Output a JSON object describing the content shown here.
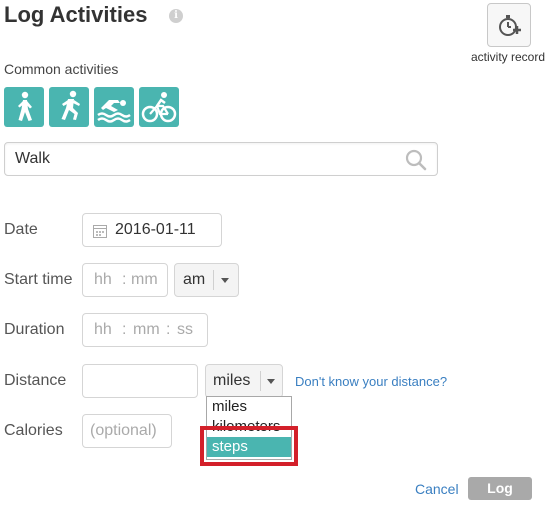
{
  "header": {
    "title": "Log Activities",
    "info_icon": "info-icon"
  },
  "activity_record": {
    "label": "activity record",
    "icon": "stopwatch-plus-icon"
  },
  "common": {
    "label": "Common activities",
    "activities": [
      {
        "name": "walk",
        "icon": "walk-icon"
      },
      {
        "name": "run",
        "icon": "run-icon"
      },
      {
        "name": "swim",
        "icon": "swim-icon"
      },
      {
        "name": "bike",
        "icon": "bike-icon"
      }
    ],
    "accent_color": "#4ab5b0"
  },
  "search": {
    "value": "Walk",
    "icon": "search-icon"
  },
  "form": {
    "date": {
      "label": "Date",
      "value": "2016-01-11",
      "icon": "calendar-icon"
    },
    "start_time": {
      "label": "Start time",
      "hh": "hh",
      "sep": ":",
      "mm": "mm",
      "ampm": "am"
    },
    "duration": {
      "label": "Duration",
      "hh": "hh",
      "sep1": ":",
      "mm": "mm",
      "sep2": ":",
      "ss": "ss"
    },
    "distance": {
      "label": "Distance",
      "value": "",
      "unit": "miles",
      "help_link": "Don't know your distance?",
      "options": [
        "miles",
        "kilometers",
        "steps"
      ],
      "highlighted_option": "steps"
    },
    "calories": {
      "label": "Calories",
      "placeholder": "(optional)"
    }
  },
  "actions": {
    "cancel": "Cancel",
    "log": "Log"
  },
  "annotation_color": "#d3202a"
}
